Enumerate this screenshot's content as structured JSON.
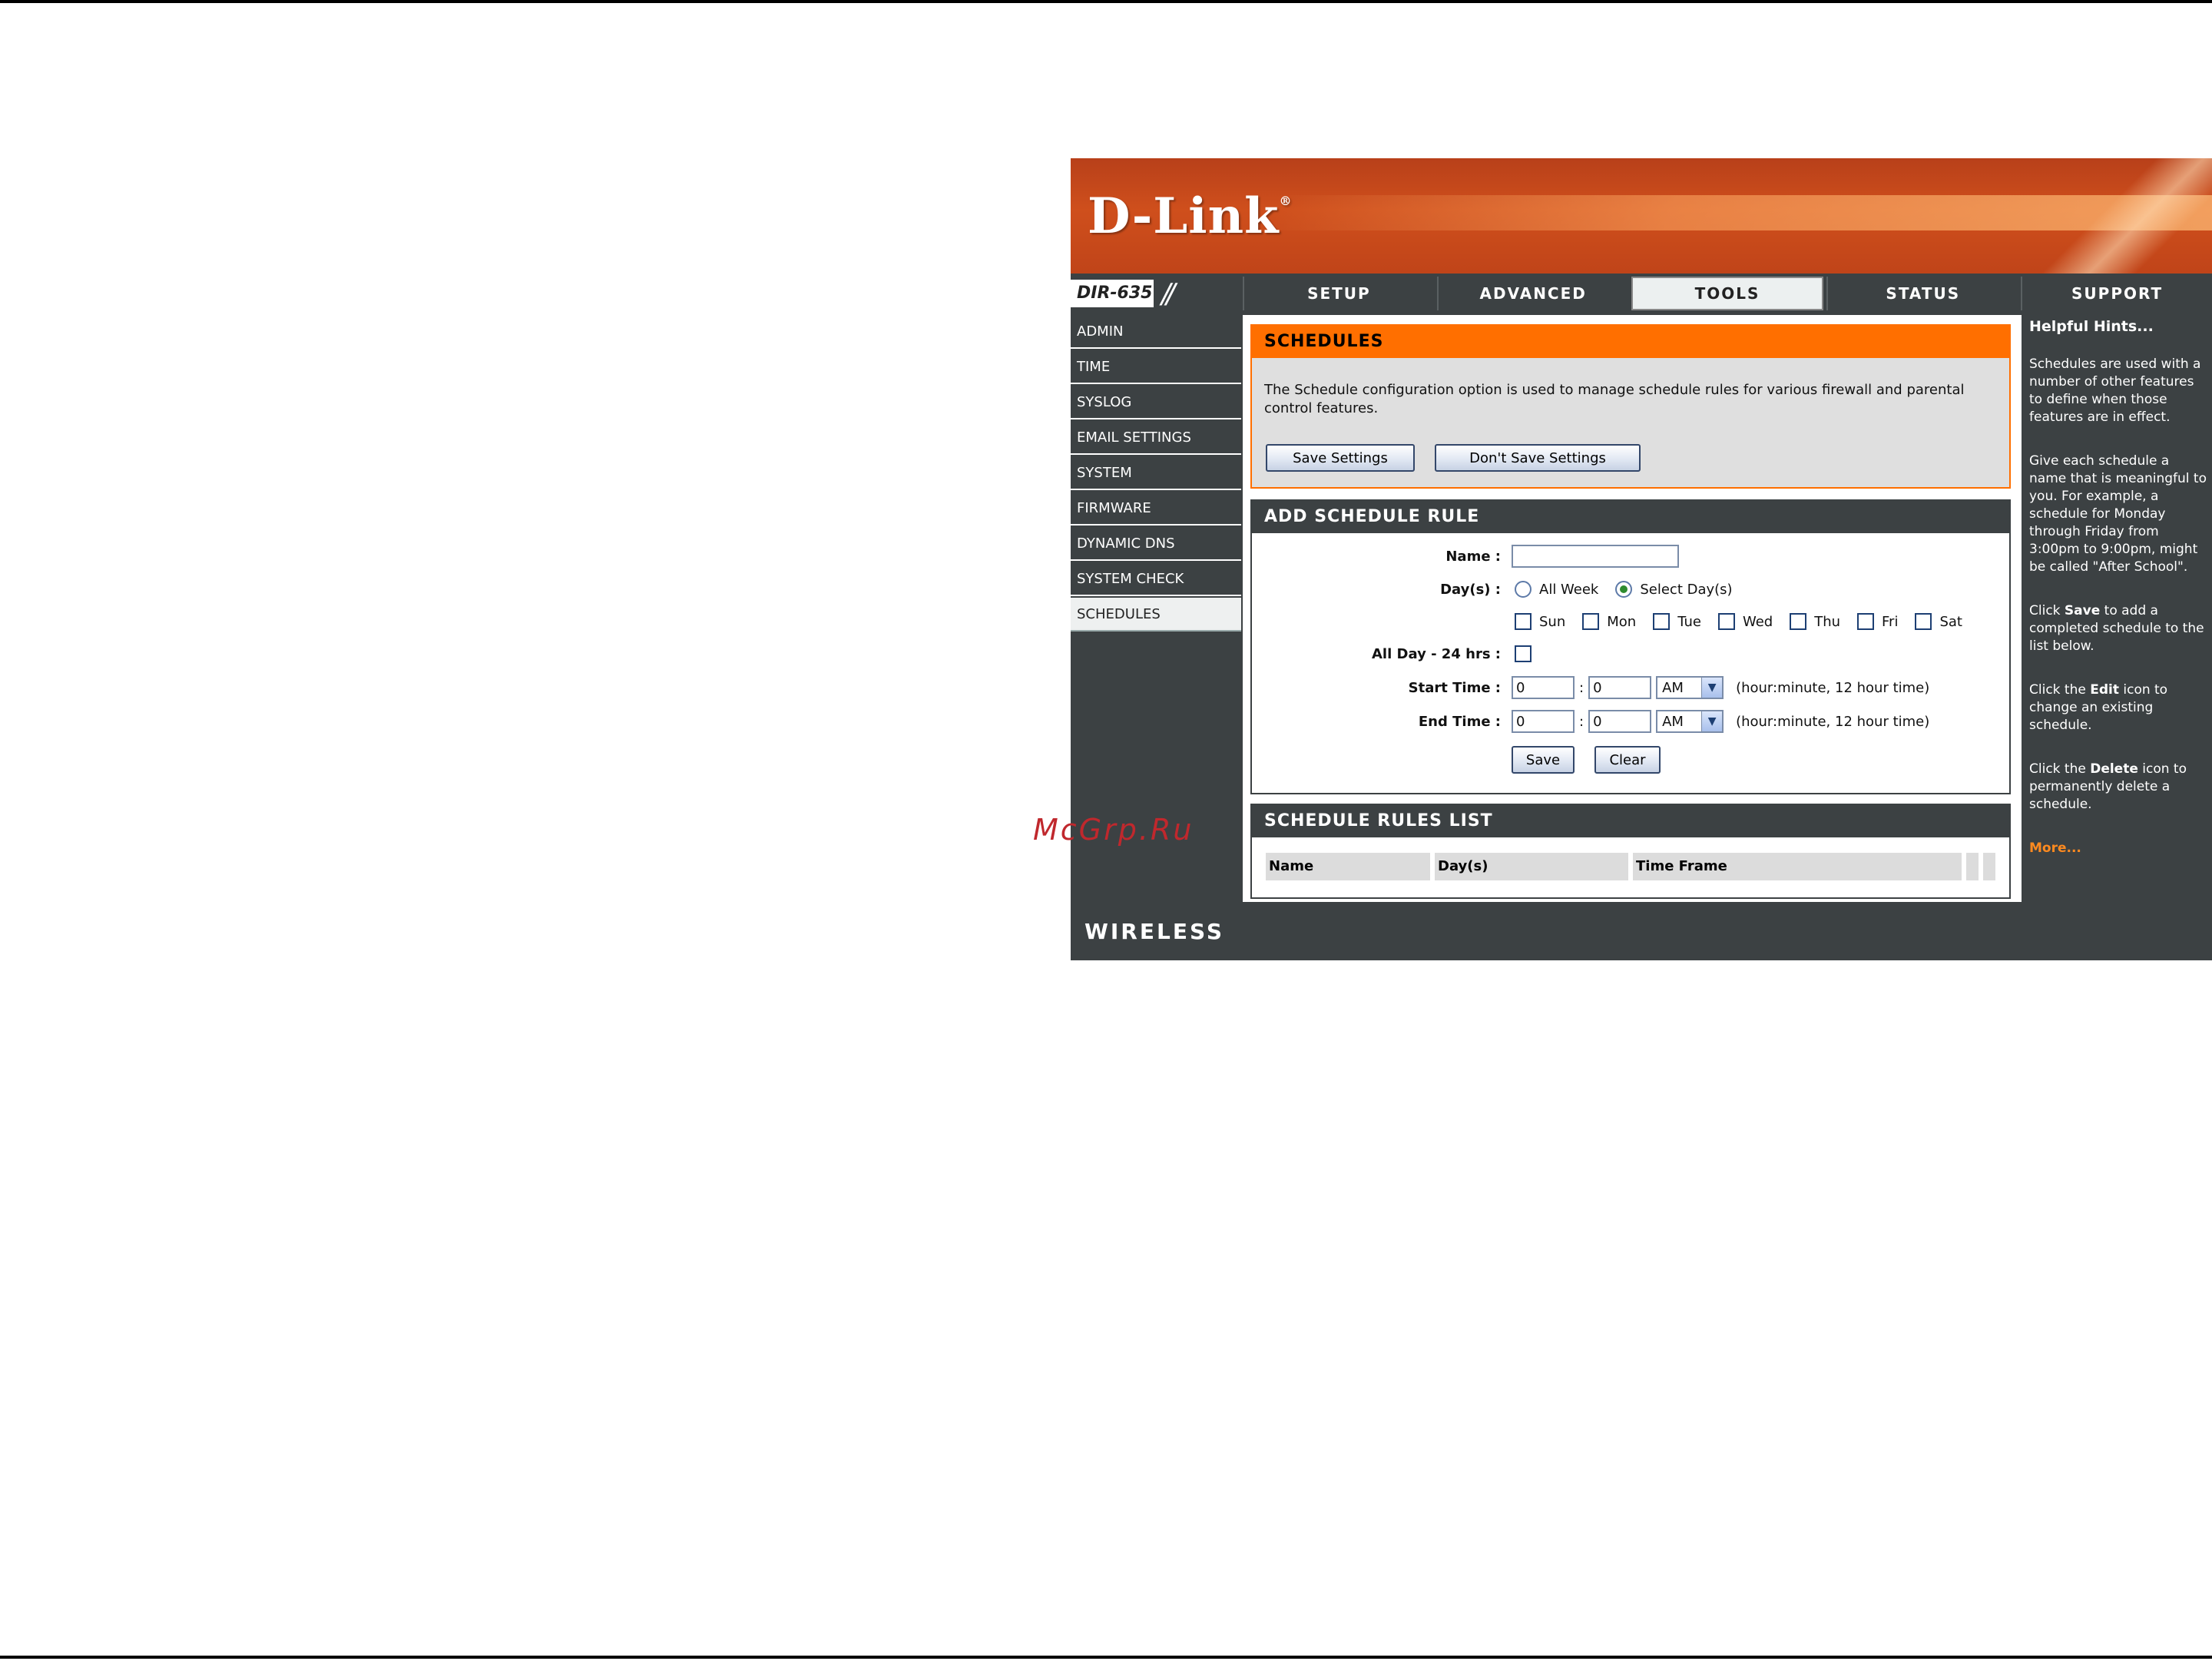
{
  "brand": {
    "logo": "D-Link",
    "logo_mark": "®",
    "model": "DIR-635",
    "model_slashes": "//",
    "footer": "WIRELESS"
  },
  "tabs": [
    {
      "label": "SETUP",
      "active": false
    },
    {
      "label": "ADVANCED",
      "active": false
    },
    {
      "label": "TOOLS",
      "active": true
    },
    {
      "label": "STATUS",
      "active": false
    },
    {
      "label": "SUPPORT",
      "active": false
    }
  ],
  "sidebar": {
    "items": [
      {
        "label": "ADMIN"
      },
      {
        "label": "TIME"
      },
      {
        "label": "SYSLOG"
      },
      {
        "label": "EMAIL SETTINGS"
      },
      {
        "label": "SYSTEM"
      },
      {
        "label": "FIRMWARE"
      },
      {
        "label": "DYNAMIC DNS"
      },
      {
        "label": "SYSTEM CHECK"
      },
      {
        "label": "SCHEDULES",
        "active": true
      }
    ]
  },
  "schedules": {
    "title": "SCHEDULES",
    "description": "The Schedule configuration option is used to manage schedule rules for various firewall and parental control features.",
    "save_settings": "Save Settings",
    "dont_save_settings": "Don't Save Settings"
  },
  "add_rule": {
    "title": "ADD SCHEDULE RULE",
    "name_label": "Name :",
    "name_value": "",
    "days_label": "Day(s) :",
    "all_week": "All Week",
    "select_days": "Select Day(s)",
    "selected_mode": "Select Day(s)",
    "days": [
      "Sun",
      "Mon",
      "Tue",
      "Wed",
      "Thu",
      "Fri",
      "Sat"
    ],
    "all_day_label": "All Day - 24 hrs :",
    "start_label": "Start Time :",
    "start_hour": "0",
    "start_minute": "0",
    "start_ampm": "AM",
    "end_label": "End Time :",
    "end_hour": "0",
    "end_minute": "0",
    "end_ampm": "AM",
    "colon": ":",
    "time_hint": "(hour:minute, 12 hour time)",
    "save": "Save",
    "clear": "Clear"
  },
  "rules_list": {
    "title": "SCHEDULE RULES LIST",
    "columns": [
      "Name",
      "Day(s)",
      "Time Frame"
    ]
  },
  "hints": {
    "title": "Helpful Hints...",
    "p1": "Schedules are used with a number of other features to define when those features are in effect.",
    "p2": "Give each schedule a name that is meaningful to you. For example, a schedule for Monday through Friday from 3:00pm to 9:00pm, might be called \"After School\".",
    "p3_pre": "Click ",
    "p3_bold": "Save",
    "p3_post": " to add a completed schedule to the list below.",
    "p4_pre": "Click the ",
    "p4_bold": "Edit",
    "p4_post": " icon to change an existing schedule.",
    "p5_pre": "Click the ",
    "p5_bold": "Delete",
    "p5_post": " icon to permanently delete a schedule.",
    "more": "More..."
  },
  "watermark": "McGrp.Ru",
  "colors": {
    "accent": "#ff6f00",
    "panel": "#3c4143",
    "banner": "#c8481b",
    "link": "#ff8a1f"
  }
}
